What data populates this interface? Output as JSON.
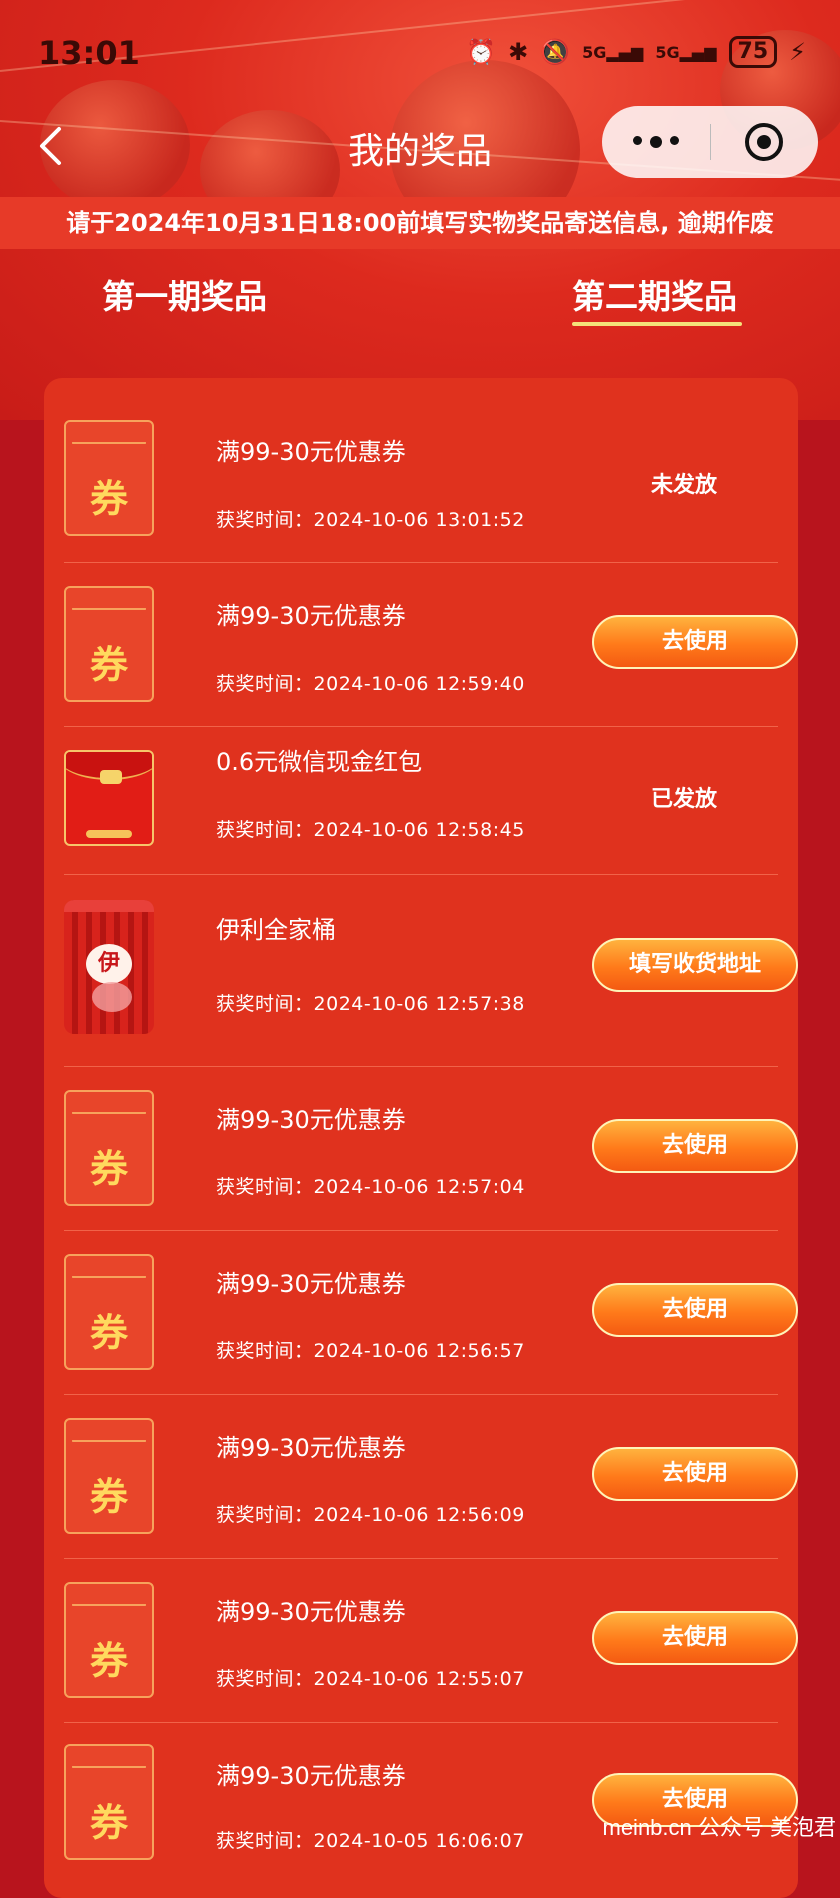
{
  "status_bar": {
    "time": "13:01",
    "network_1": "5G",
    "network_2": "5G",
    "battery": "75"
  },
  "nav": {
    "title": "我的奖品"
  },
  "notice": "请于2024年10月31日18:00前填写实物奖品寄送信息, 逾期作废",
  "tabs": [
    {
      "label": "第一期奖品",
      "active": false
    },
    {
      "label": "第二期奖品",
      "active": true
    }
  ],
  "time_label": "获奖时间：",
  "coupon_glyph": "券",
  "bucket_logo": "伊",
  "prizes": [
    {
      "name": "满99-30元优惠券",
      "time": "2024-10-06 13:01:52",
      "icon": "coupon-icon",
      "status": "未发放"
    },
    {
      "name": "满99-30元优惠券",
      "time": "2024-10-06 12:59:40",
      "icon": "coupon-icon",
      "button": "去使用"
    },
    {
      "name": "0.6元微信现金红包",
      "time": "2024-10-06 12:58:45",
      "icon": "red-envelope-icon",
      "status": "已发放"
    },
    {
      "name": "伊利全家桶",
      "time": "2024-10-06 12:57:38",
      "icon": "milk-bucket-image",
      "button": "填写收货地址"
    },
    {
      "name": "满99-30元优惠券",
      "time": "2024-10-06 12:57:04",
      "icon": "coupon-icon",
      "button": "去使用"
    },
    {
      "name": "满99-30元优惠券",
      "time": "2024-10-06 12:56:57",
      "icon": "coupon-icon",
      "button": "去使用"
    },
    {
      "name": "满99-30元优惠券",
      "time": "2024-10-06 12:56:09",
      "icon": "coupon-icon",
      "button": "去使用"
    },
    {
      "name": "满99-30元优惠券",
      "time": "2024-10-06 12:55:07",
      "icon": "coupon-icon",
      "button": "去使用"
    },
    {
      "name": "满99-30元优惠券",
      "time": "2024-10-05 16:06:07",
      "icon": "coupon-icon",
      "button": "去使用"
    }
  ],
  "watermark": "meinb.cn  公众号 美泡君",
  "colors": {
    "background": "#b8141d",
    "panel": "#e0321e",
    "notice_bar": "#e73a28",
    "button_gradient_top": "#ffb23e",
    "button_gradient_bottom": "#f45a12",
    "tab_underline": "#f5e27a",
    "coupon_glyph": "#ffd95e"
  }
}
